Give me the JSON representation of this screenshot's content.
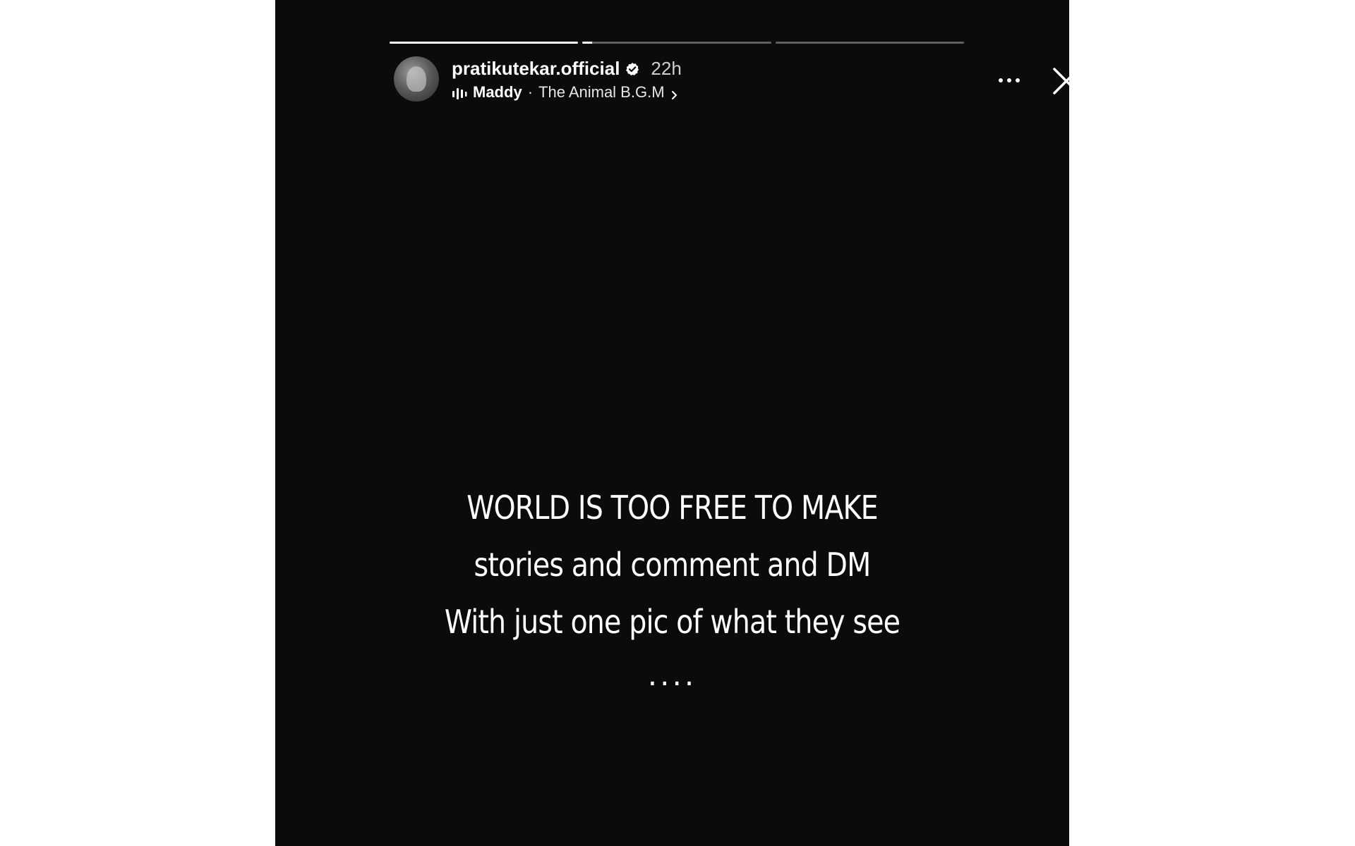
{
  "story": {
    "progress_segments": [
      {
        "fill": 1.0
      },
      {
        "fill": 0.05
      },
      {
        "fill": 0.0
      }
    ],
    "header": {
      "username": "pratikutekar.official",
      "verified": true,
      "timestamp": "22h",
      "music": {
        "artist": "Maddy",
        "separator": "·",
        "song": "The Animal B.G.M",
        "chevron": "›"
      }
    },
    "text_lines": [
      "WORLD IS TOO FREE TO MAKE",
      "stories and comment and DM",
      "With just one pic of what they see"
    ],
    "ellipsis": "....",
    "icons": {
      "verified": "verified-badge-icon",
      "audio": "audio-bars-icon",
      "more": "more-horizontal-icon",
      "close": "close-icon",
      "chevron": "chevron-right-icon"
    },
    "colors": {
      "background": "#0b0b0b",
      "page": "#ffffff",
      "text": "#ffffff"
    }
  }
}
